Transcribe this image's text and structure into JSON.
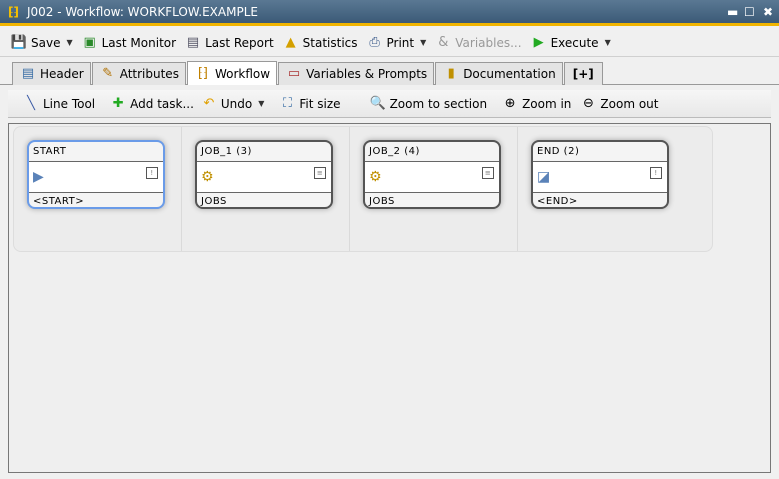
{
  "window": {
    "title": "J002 - Workflow: WORKFLOW.EXAMPLE",
    "controls": [
      "▬",
      "☐",
      "✖"
    ]
  },
  "toolbar": {
    "save": "Save",
    "last_monitor": "Last Monitor",
    "last_report": "Last Report",
    "statistics": "Statistics",
    "print": "Print",
    "variables": "Variables...",
    "execute": "Execute"
  },
  "tabs": [
    {
      "label": "Header"
    },
    {
      "label": "Attributes"
    },
    {
      "label": "Workflow"
    },
    {
      "label": "Variables & Prompts"
    },
    {
      "label": "Documentation"
    },
    {
      "label": "[+]"
    }
  ],
  "workflow_toolbar": {
    "line_tool": "Line Tool",
    "add_task": "Add task...",
    "undo": "Undo",
    "fit_size": "Fit size",
    "zoom_section": "Zoom to section",
    "zoom_in": "Zoom in",
    "zoom_out": "Zoom out"
  },
  "nodes": [
    {
      "title": "START",
      "footer": "<START>",
      "icon": "start-triangle-icon"
    },
    {
      "title": "JOB_1 (3)",
      "footer": "JOBS",
      "icon": "job-icon"
    },
    {
      "title": "JOB_2 (4)",
      "footer": "JOBS",
      "icon": "job-icon"
    },
    {
      "title": "END (2)",
      "footer": "<END>",
      "icon": "end-icon"
    }
  ]
}
